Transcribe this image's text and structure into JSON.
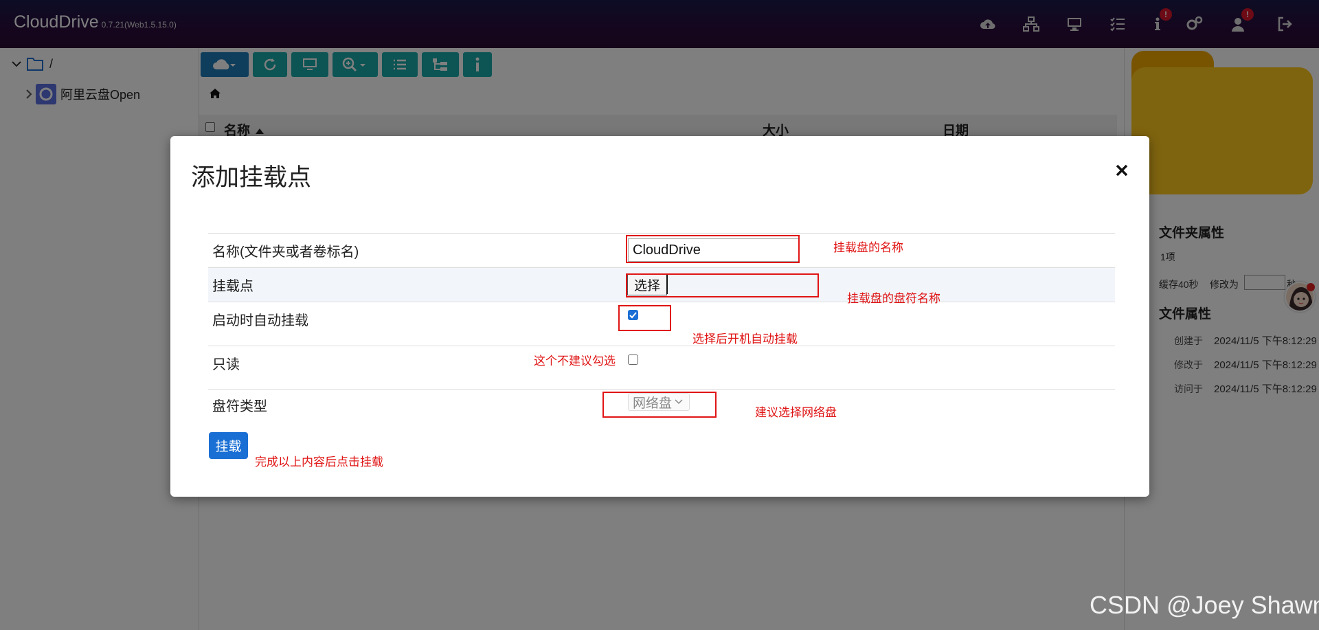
{
  "app": {
    "name": "CloudDrive",
    "version": "0.7.21(Web1.5.15.0)"
  },
  "topbar": {
    "icons": [
      "cloud-upload-icon",
      "network-icon",
      "desktop-icon",
      "tasks-icon",
      "info-icon",
      "settings-icon",
      "user-icon",
      "logout-icon"
    ],
    "info_badge": "!",
    "user_badge": "!"
  },
  "sidebar": {
    "root_label": "/",
    "items": [
      {
        "label": "阿里云盘Open"
      }
    ]
  },
  "main": {
    "table_headers": {
      "name": "名称",
      "size": "大小",
      "date": "日期"
    }
  },
  "right_panel": {
    "folder_props_title": "文件夹属性",
    "item_count": "1项",
    "cache_label": "缓存40秒",
    "modify_label": "修改为",
    "seconds_label": "秒",
    "file_props_title": "文件属性",
    "created_label": "创建于",
    "created_value": "2024/11/5 下午8:12:29",
    "modified_label": "修改于",
    "modified_value": "2024/11/5 下午8:12:29",
    "accessed_label": "访问于",
    "accessed_value": "2024/11/5 下午8:12:29"
  },
  "modal": {
    "title": "添加挂载点",
    "name_label": "名称(文件夹或者卷标名)",
    "name_value": "CloudDrive",
    "mountpoint_label": "挂载点",
    "choose_button": "选择",
    "automount_label": "启动时自动挂载",
    "automount_checked": true,
    "readonly_label": "只读",
    "readonly_checked": false,
    "drive_type_label": "盘符类型",
    "drive_type_value": "网络盘",
    "mount_button": "挂载"
  },
  "annotations": {
    "name_note": "挂载盘的名称",
    "mountpoint_note": "挂载盘的盘符名称",
    "automount_note": "选择后开机自动挂载",
    "readonly_note": "这个不建议勾选",
    "drive_type_note": "建议选择网络盘",
    "mount_note": "完成以上内容后点击挂载",
    "color": "#e01414"
  },
  "watermark": "CSDN @Joey Shawn"
}
